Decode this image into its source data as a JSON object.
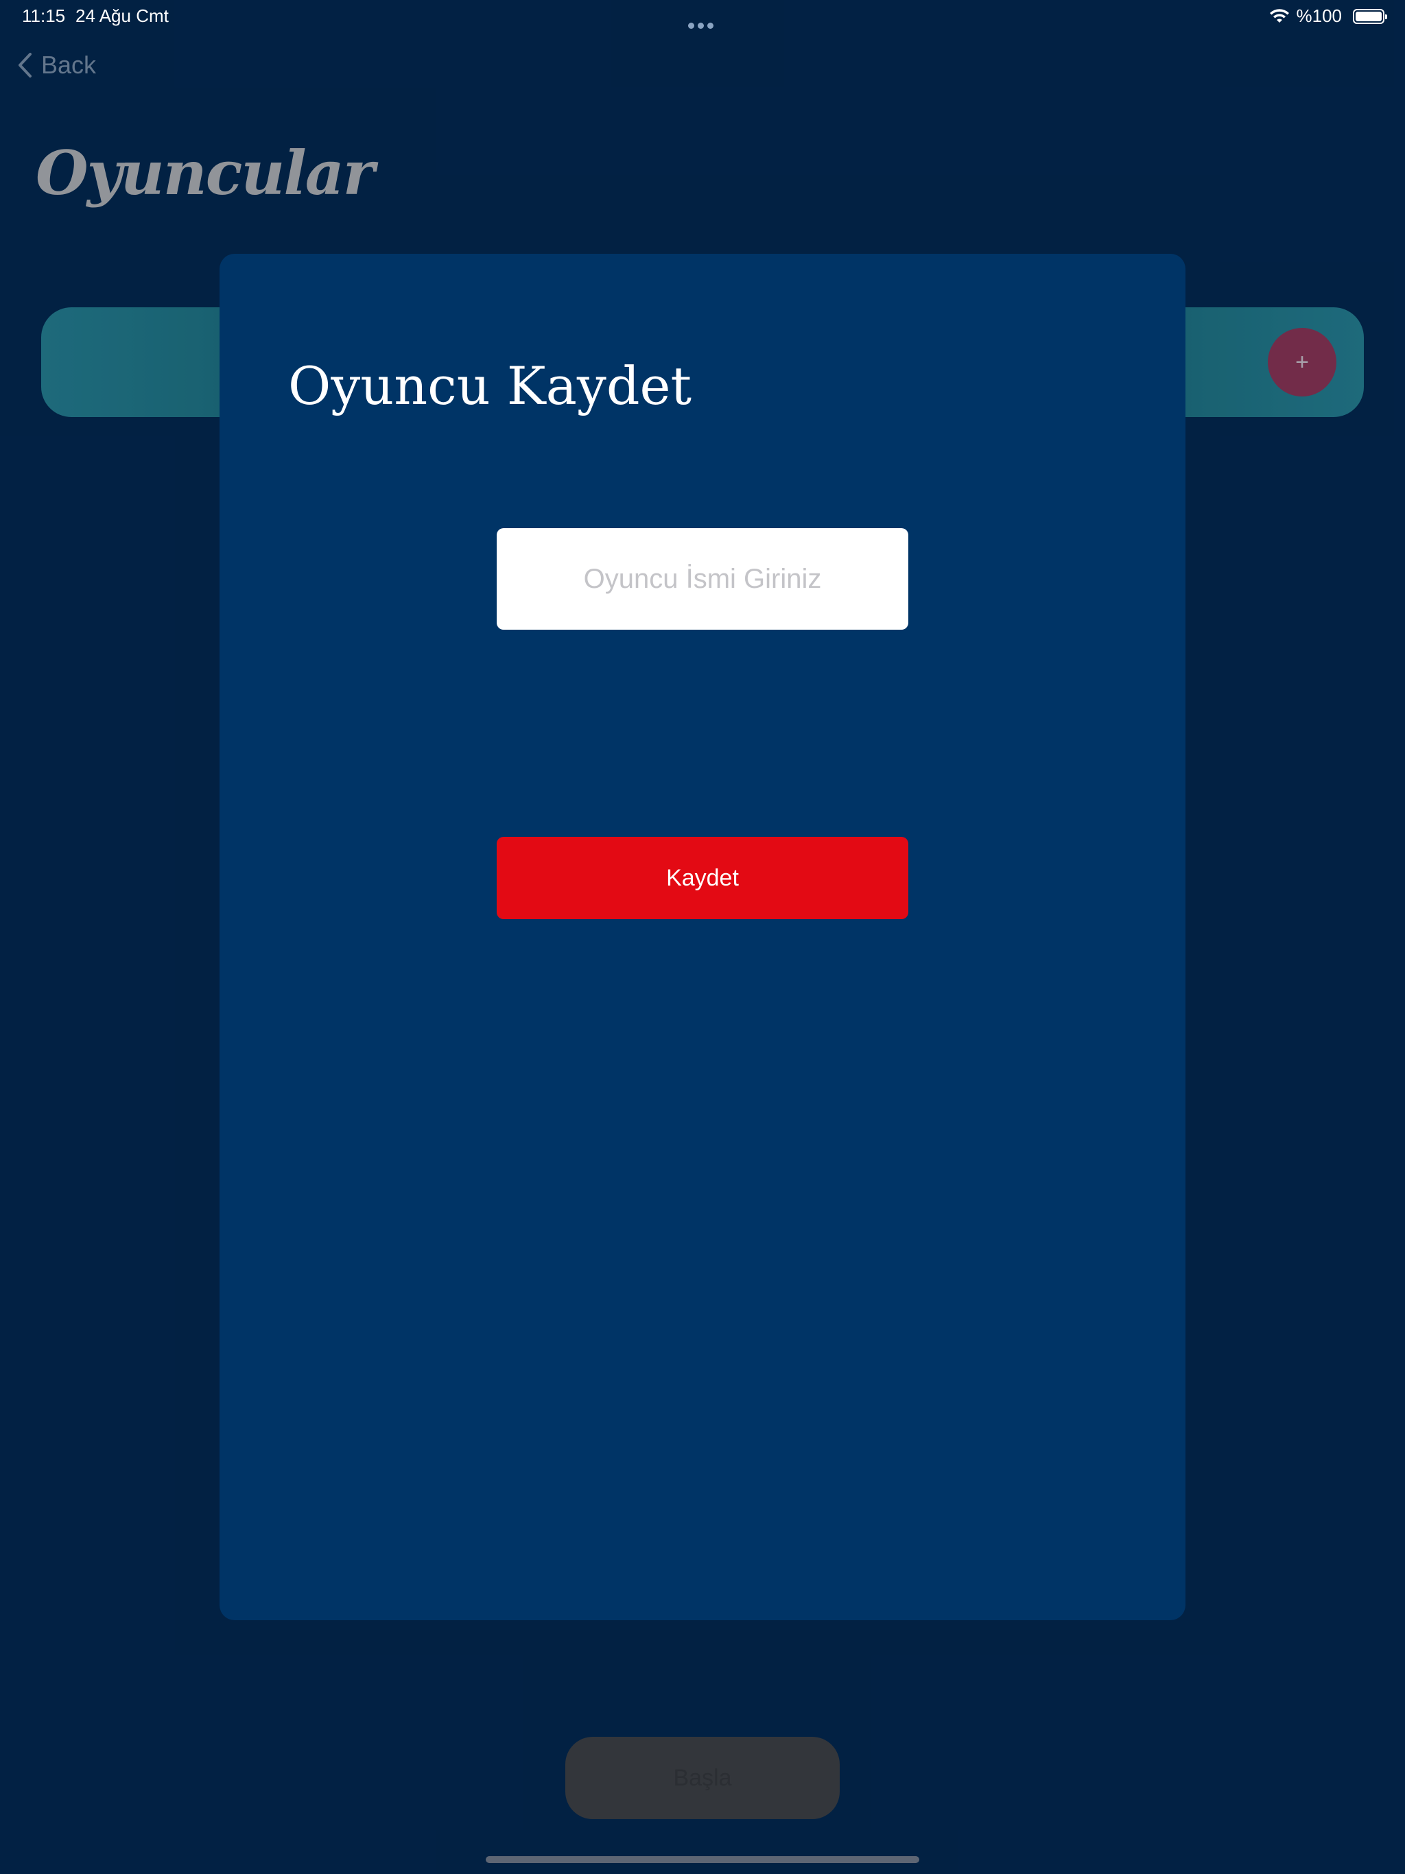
{
  "status_bar": {
    "time": "11:15",
    "date": "24 Ağu Cmt",
    "battery_percent": "%100"
  },
  "nav": {
    "back_label": "Back"
  },
  "page": {
    "title": "Oyuncular",
    "add_button_label": "+",
    "start_button_label": "Başla"
  },
  "modal": {
    "title": "Oyuncu Kaydet",
    "name_input": {
      "value": "",
      "placeholder": "Oyuncu İsmi Giriniz"
    },
    "save_label": "Kaydet"
  },
  "colors": {
    "background": "#032a52",
    "modal": "#003466",
    "save_button": "#e30a14",
    "player_bar": "#1f7c8a",
    "add_button": "#9e3a5a"
  },
  "icons": {
    "back": "chevron-left-icon",
    "wifi": "wifi-icon",
    "battery": "battery-icon"
  }
}
